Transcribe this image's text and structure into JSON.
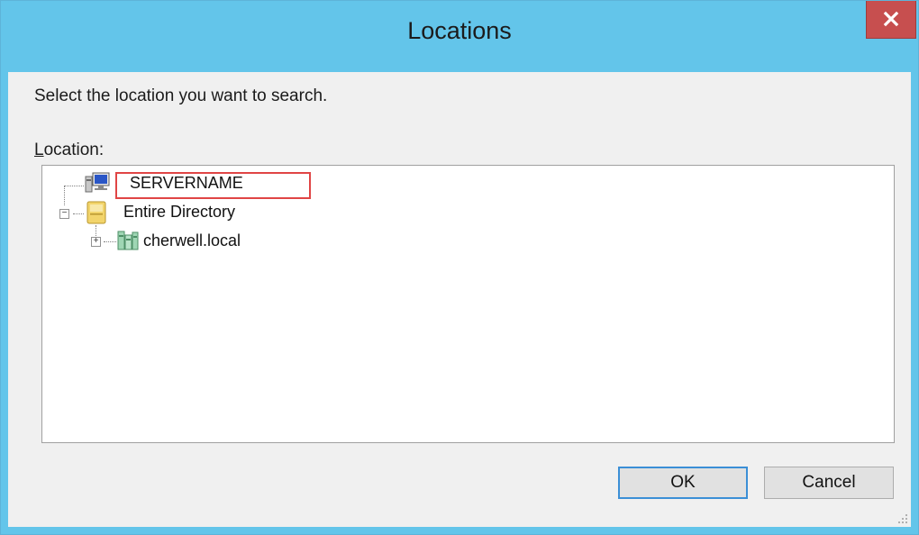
{
  "dialog": {
    "title": "Locations",
    "instruction": "Select the location you want to search.",
    "location_label_accel": "L",
    "location_label_rest": "ocation:"
  },
  "tree": {
    "items": [
      {
        "label": "SERVERNAME",
        "icon": "computer-icon",
        "highlighted": true
      },
      {
        "label": "Entire Directory",
        "icon": "directory-folder-icon",
        "expanded": true
      },
      {
        "label": "cherwell.local",
        "icon": "domain-icon",
        "expanded": false
      }
    ]
  },
  "buttons": {
    "ok_label": "OK",
    "cancel_label": "Cancel"
  },
  "colors": {
    "titlebar": "#63c5ea",
    "close_button": "#c74f4f",
    "highlight_box": "#e04545"
  }
}
